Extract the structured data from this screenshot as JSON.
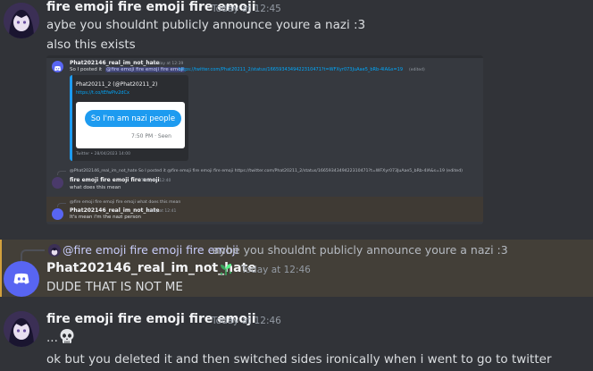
{
  "messages": [
    {
      "username": "fire emoji fire emoji fire emoji",
      "timestamp": "Today at 12:45",
      "lines": [
        "aybe you shouldnt publicly announce youre a nazi :3",
        "also this exists"
      ]
    },
    {
      "reply": {
        "mention": "@fire emoji fire emoji fire emoji",
        "text": "aybe you shouldnt publicly announce youre a nazi :3"
      },
      "username": "Phat202146_real_im_not_hate",
      "badge_icon": "sprout-icon",
      "timestamp": "Today at 12:46",
      "lines": [
        "DUDE THAT IS NOT ME"
      ]
    },
    {
      "username": "fire emoji fire emoji fire emoji",
      "timestamp": "Today at 12:46",
      "lines": [
        "... ",
        "ok but you deleted it and then switched sides ironically when i went to go to twitter"
      ],
      "emoji_icon": "skull-icon"
    }
  ],
  "screenshot": {
    "msg1": {
      "username": "Phat202146_real_im_not_hate",
      "timestamp": "Today at 12:39",
      "prefix": "So I posted it",
      "mention": "@fire emoji fire emoji fire emoji",
      "link": "https://twitter.com/Phat20211_2/status/1665934349422310471?t=WFXyr073JuAae5_bRb-4lA&s=19",
      "edited": "(edited)"
    },
    "tweet": {
      "author": "Phat20211_2 (@Phat20211_2)",
      "link": "https://t.co/tEfwPiv2dCx",
      "bubble": "So I'm am nazi people",
      "status": "7:50 PM · Seen",
      "footer": "Twitter • 28/04/2023 14:00"
    },
    "msg2": {
      "reply_preview": "@Phat202146_real_im_not_hate So I posted it @fire emoji fire emoji fire emoji https://twitter.com/Phat20211_2/status/1665934349422310471?t=WFXyr073JuAae5_bRb-4lA&s=19 (edited)",
      "username": "fire emoji fire emoji fire emoji",
      "timestamp": "Today at 12:40",
      "text": "what does this mean"
    },
    "msg3": {
      "reply_preview": "@fire emoji fire emoji fire emoji what does this mean",
      "username": "Phat202146_real_im_not_hate",
      "timestamp": "Today at 12:41",
      "text": "It's mean i'm the nazi person"
    }
  },
  "colors": {
    "background": "#313338",
    "highlight": "#433f38",
    "mention": "#c9cdfb",
    "link": "#00a8fc",
    "discord_blurple": "#5865f2",
    "twitter_blue": "#1d9bf0"
  }
}
